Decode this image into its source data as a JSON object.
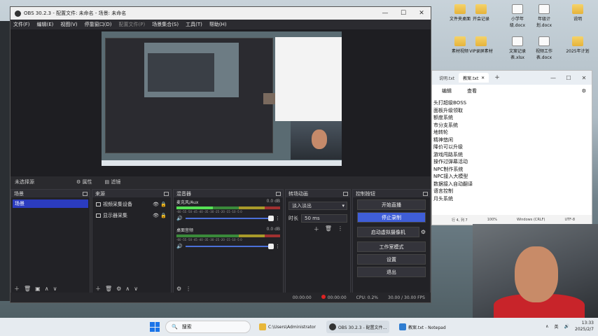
{
  "desktop": {
    "icons": [
      {
        "label": "文件夹桌面",
        "type": "folder"
      },
      {
        "label": "开会记录",
        "type": "folder"
      },
      {
        "label": "小学年级.docx",
        "type": "doc"
      },
      {
        "label": "年级计划.docx",
        "type": "doc"
      },
      {
        "label": "说明",
        "type": "folder"
      },
      {
        "label": "素材视频",
        "type": "folder"
      },
      {
        "label": "VIP录屏素材",
        "type": "folder"
      },
      {
        "label": "文案记录表.xlsx",
        "type": "doc"
      },
      {
        "label": "视频工作表.docx",
        "type": "doc"
      },
      {
        "label": "2025年计划",
        "type": "folder"
      }
    ]
  },
  "obs": {
    "title": "OBS 30.2.3 - 配置文件: 未命名 - 场景: 未命名",
    "menu": [
      "文件(F)",
      "编辑(E)",
      "视图(V)",
      "停靠窗口(D)",
      "配置文件(P)",
      "场景集合(S)",
      "工具(T)",
      "帮助(H)"
    ],
    "status_strip": {
      "source": "未选择源",
      "props": "属性",
      "filters": "滤镜"
    },
    "scenes": {
      "title": "场景",
      "items": [
        "场景"
      ]
    },
    "sources": {
      "title": "来源",
      "items": [
        "视频采集设备",
        "显示器采集"
      ]
    },
    "mixer": {
      "title": "混音器",
      "channels": [
        {
          "name": "麦克风/Aux",
          "db": "0.0 dB",
          "level": 0.35
        },
        {
          "name": "桌面音频",
          "db": "0.0 dB",
          "level": 0.0
        }
      ],
      "ticks": "-60 -55 -50 -45 -40 -35 -30 -25 -20 -15 -10 -5 0"
    },
    "transitions": {
      "title": "转场动画",
      "type": "淡入淡出",
      "duration_label": "时长",
      "duration": "50 ms"
    },
    "controls": {
      "title": "控制按钮",
      "buttons": [
        {
          "label": "开始直播",
          "active": false
        },
        {
          "label": "停止录制",
          "active": true
        },
        {
          "label": "启动虚拟摄像机",
          "active": false
        },
        {
          "label": "工作室模式",
          "active": false
        },
        {
          "label": "设置",
          "active": false
        },
        {
          "label": "退出",
          "active": false
        }
      ]
    },
    "statusbar": {
      "stream_time": "00:00:00",
      "rec_time": "00:00:00",
      "cpu": "CPU: 0.2%",
      "fps": "30.00 / 30.00 FPS"
    }
  },
  "notepad": {
    "tab_prev": "说明.txt",
    "tab_active": "教案.txt",
    "menu": [
      "编辑",
      "查看"
    ],
    "lines": [
      "头打超级BOSS",
      "面板升级领取",
      "额度系统",
      "市分支系统",
      "地转轮",
      "精神悠闲",
      "降价可以升级",
      "游戏闯路系统",
      "操作过弹幕活动",
      "NPC制作系统",
      "NPC接入大模型",
      "数据接入自动翻译",
      "语言控制",
      "月头系统"
    ],
    "status": [
      "行 4, 列 7",
      "100%",
      "Windows (CRLF)",
      "UTF-8"
    ]
  },
  "taskbar": {
    "search": "搜索",
    "apps": [
      {
        "label": "C:\\Users\\Administrator",
        "color": "#e8b73a"
      },
      {
        "label": "OBS 30.2.3 - 配置文件...",
        "color": "#333333"
      },
      {
        "label": "教案.txt - Notepad",
        "color": "#2f7dd1"
      }
    ],
    "tray": [
      "∧",
      "英",
      "🔊"
    ],
    "time": "13:33",
    "date": "2025/2/7"
  }
}
